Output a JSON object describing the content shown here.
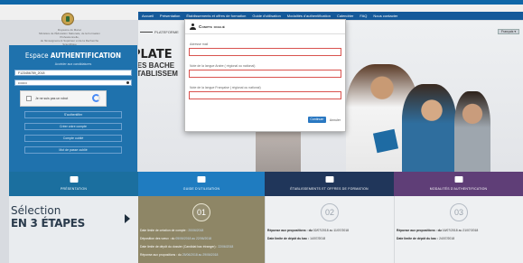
{
  "header": {
    "ministry_text": "Royaume du Maroc\nMinistère de l'Éducation Nationale, de la Formation Professionnelle,\nde l'Enseignement Supérieur et de la Recherche Scientifique",
    "nav_items": [
      "Accueil",
      "Présentation",
      "Établissements et offres de formation",
      "Guide d'utilisation",
      "Modalités d'authentification",
      "Calendrier",
      "FAQ",
      "Nous contacter"
    ]
  },
  "login": {
    "espace_prefix": "Espace ",
    "espace_bold": "AUTHENTIFICATION",
    "acces_label": "Accéder aux candidatures",
    "login_value": "F123456789_2018",
    "password_value": "••••••••",
    "captcha_label": "Je ne suis pas un robot",
    "btn_connect": "S'authentifier",
    "btn_create": "Créer votre compte",
    "btn_forgot": "Compte oublié",
    "btn_password": "Mot de passe oublié"
  },
  "hero": {
    "tab_label": "PLATEFORME",
    "plate_title": "PLATE",
    "plate_sub1": "DES BACHE",
    "plate_sub2": "ÉTABLISSEM",
    "lang_button": "Français ▾"
  },
  "modal": {
    "title": "Compte oublié",
    "field1_label": "Adresse mail",
    "field2_label": "Note de la langue Arabe ( régional ou national)",
    "field3_label": "Note de la langue Française ( régional ou national)",
    "submit_label": "Continuer",
    "cancel_label": "Annuler"
  },
  "features": [
    {
      "label": "PRÉSENTATION"
    },
    {
      "label": "GUIDE D'UTILISATION"
    },
    {
      "label": "ÉTABLISSEMENTS ET OFFRES DE FORMATION"
    },
    {
      "label": "MODALITÉS D'AUTHENTIFICATION"
    }
  ],
  "steps": {
    "title_line1": "Sélection",
    "title_line2": "EN 3 ÉTAPES",
    "step1": {
      "num": "01",
      "lines": [
        {
          "text": "Date limite de création de compte : ",
          "hl": "20/06/2018"
        },
        {
          "text": "Déposition des vœux : du ",
          "hl": "05/06/2018 au 22/06/2018"
        },
        {
          "text": "Date limite de dépôt du dossier (Candidat bac étranger) : ",
          "hl": "22/06/2018"
        },
        {
          "text": "Réponse aux propositions : du ",
          "hl": "25/06/2018 au 29/06/2018"
        }
      ]
    },
    "step2": {
      "num": "02",
      "lines": [
        {
          "text": "Réponse aux propositions : du ",
          "hl": "02/07/2018 au 11/07/2018"
        },
        {
          "text": "Date limite de dépôt du bac : ",
          "hl": "14/07/2018"
        }
      ]
    },
    "step3": {
      "num": "03",
      "lines": [
        {
          "text": "Réponse aux propositions : du ",
          "hl": "16/07/2018 au 21/07/2018"
        },
        {
          "text": "Date limite de dépôt du bac : ",
          "hl": "24/07/2018"
        }
      ]
    }
  }
}
